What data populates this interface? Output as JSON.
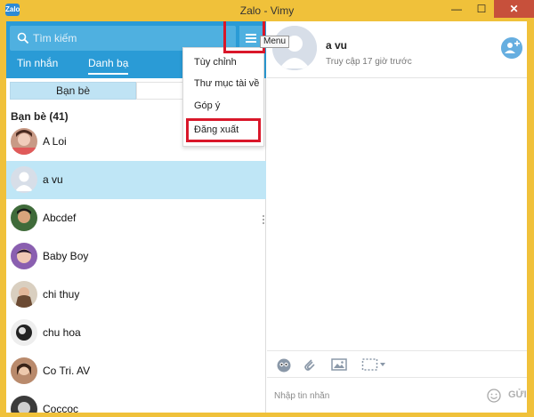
{
  "window": {
    "title": "Zalo - Vimy",
    "app_icon_text": "Zalo",
    "minimize_glyph": "—",
    "maximize_glyph": "☐",
    "close_glyph": "✕"
  },
  "search": {
    "placeholder": "Tìm kiếm",
    "value": ""
  },
  "menu": {
    "tooltip": "Menu"
  },
  "tabs": [
    {
      "label": "Tin nhắn",
      "active": false
    },
    {
      "label": "Danh bạ",
      "active": true
    }
  ],
  "segments": {
    "first": "Bạn bè",
    "second": ""
  },
  "dropdown": {
    "items": [
      {
        "label": "Tùy chỉnh"
      },
      {
        "label": "Thư mục tài về"
      },
      {
        "label": "Góp ý"
      },
      {
        "label": "Đăng xuất"
      }
    ],
    "highlighted": "Đăng xuất"
  },
  "contacts": {
    "group_label": "Bạn bè (41)",
    "items": [
      {
        "name": "A Loi",
        "selected": false
      },
      {
        "name": "a vu",
        "selected": true
      },
      {
        "name": "Abcdef",
        "selected": false
      },
      {
        "name": "Baby Boy",
        "selected": false
      },
      {
        "name": "chi thuy",
        "selected": false
      },
      {
        "name": "chu hoa",
        "selected": false
      },
      {
        "name": "Co Tri. AV",
        "selected": false
      },
      {
        "name": "Coccoc",
        "selected": false
      }
    ]
  },
  "chat": {
    "name": "a vu",
    "status": "Truy cập 17 giờ trước",
    "input_placeholder": "Nhập tin nhắn",
    "send_label": "GỬI"
  },
  "colors": {
    "window_frame": "#f0c13a",
    "header_blue": "#2a9bd6",
    "selected_row": "#bfe6f6",
    "highlight_red": "#d9172a"
  }
}
